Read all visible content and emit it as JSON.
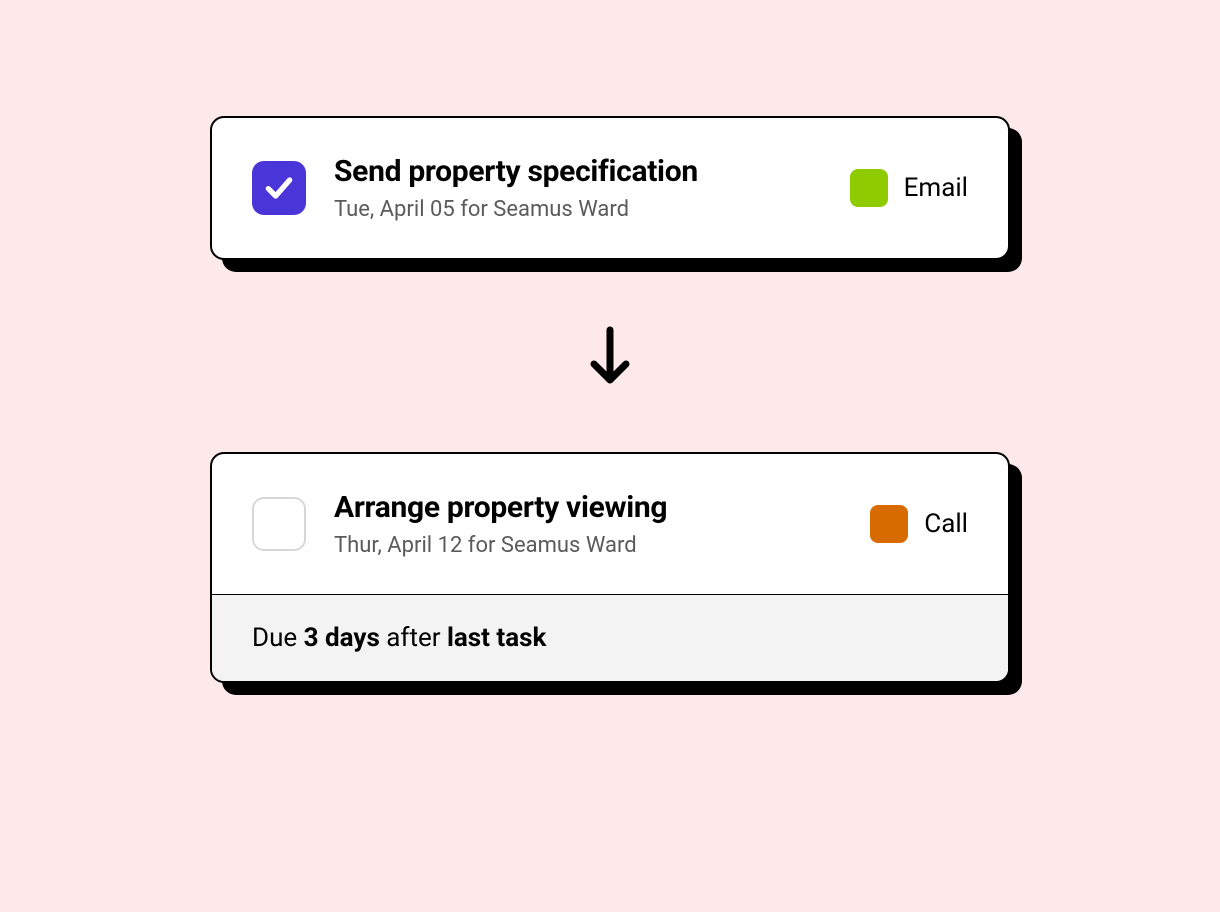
{
  "task1": {
    "title": "Send property specification",
    "subtitle": "Tue, April 05 for Seamus Ward",
    "tag_label": "Email",
    "checked": true
  },
  "task2": {
    "title": "Arrange property viewing",
    "subtitle": "Thur, April 12 for Seamus Ward",
    "tag_label": "Call",
    "checked": false
  },
  "due": {
    "prefix": "Due ",
    "days": "3 days",
    "mid": " after ",
    "ref": "last task"
  },
  "colors": {
    "checkbox_checked": "#4a35d8",
    "email_swatch": "#8ecc00",
    "call_swatch": "#d86b00",
    "page_bg": "#fde8ea",
    "footer_bg": "#f3f3f3"
  }
}
